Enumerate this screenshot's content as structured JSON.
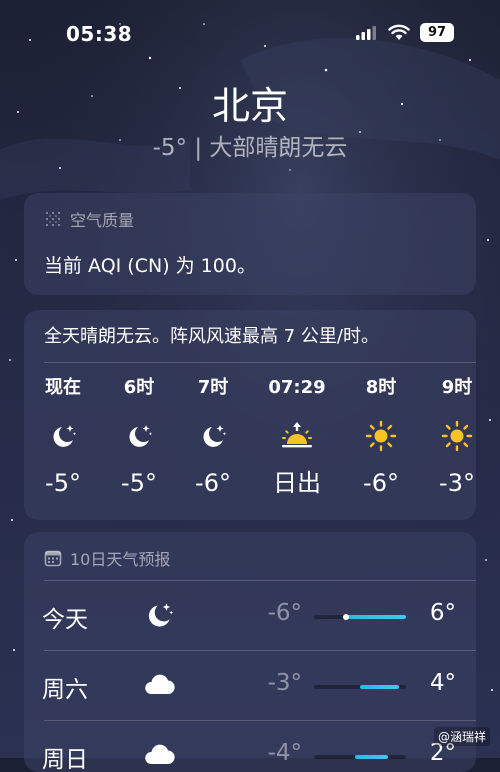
{
  "status_bar": {
    "time": "05:38",
    "battery": "97"
  },
  "header": {
    "city": "北京",
    "summary": "-5° | 大部晴朗无云"
  },
  "air_quality": {
    "title": "空气质量",
    "text": "当前 AQI (CN) 为 100。"
  },
  "hourly": {
    "description": "全天晴朗无云。阵风风速最高 7 公里/时。",
    "items": [
      {
        "label": "现在",
        "icon": "moon-stars-icon",
        "temp": "-5°"
      },
      {
        "label": "6时",
        "icon": "moon-stars-icon",
        "temp": "-5°"
      },
      {
        "label": "7时",
        "icon": "moon-stars-icon",
        "temp": "-6°"
      },
      {
        "label": "07:29",
        "icon": "sunrise-icon",
        "temp": "日出"
      },
      {
        "label": "8时",
        "icon": "sun-icon",
        "temp": "-6°"
      },
      {
        "label": "9时",
        "icon": "sun-icon",
        "temp": "-3°"
      }
    ]
  },
  "daily": {
    "title": "10日天气预报",
    "items": [
      {
        "day": "今天",
        "icon": "moon-stars-icon",
        "low": "-6°",
        "high": "6°",
        "range_start": 0.35,
        "range_end": 1.0,
        "current_marker": 0.35
      },
      {
        "day": "周六",
        "icon": "cloud-icon",
        "low": "-3°",
        "high": "4°",
        "range_start": 0.5,
        "range_end": 0.92
      },
      {
        "day": "周日",
        "icon": "cloud-icon",
        "low": "-4°",
        "high": "2°",
        "range_start": 0.45,
        "range_end": 0.8
      }
    ]
  },
  "watermark": "@涵瑞祥",
  "colors": {
    "sun": "#f7c325",
    "range_bar": "#34c0ee"
  }
}
